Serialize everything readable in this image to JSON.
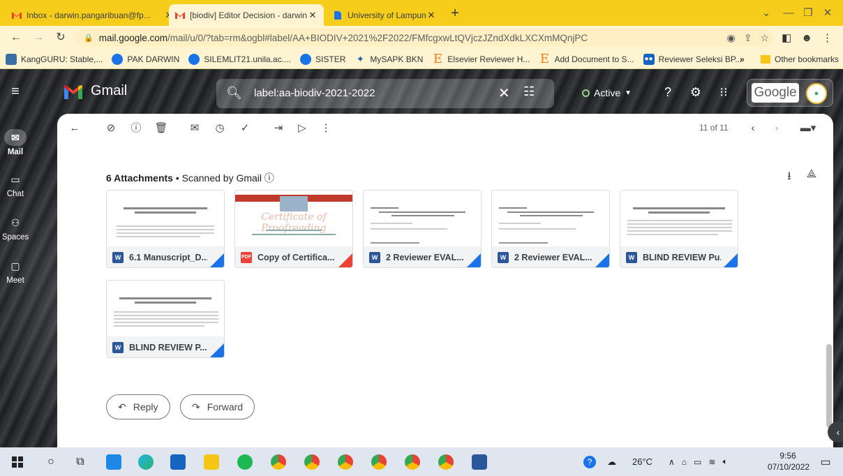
{
  "browser": {
    "tabs": [
      {
        "label": "Inbox - darwin.pangaribuan@fp...",
        "icon": "gmail-icon",
        "active": false
      },
      {
        "label": "[biodiv] Editor Decision - darwin...",
        "icon": "gmail-icon",
        "active": true
      },
      {
        "label": "University of Lampung | LPPM-U...",
        "icon": "doc-icon",
        "active": false
      }
    ],
    "close_glyph": "✕",
    "newtab_glyph": "+",
    "url_host": "mail.google.com",
    "url_path": "/mail/u/0/?tab=rm&ogbl#label/AA+BIODIV+2021%2F2022/FMfcgxwLtQVjczJZndXdkLXCXmMQnjPC",
    "bookmarks": [
      {
        "label": "KangGURU: Stable,...",
        "icon": "kangguru-icon",
        "color": "#3a6ea5"
      },
      {
        "label": "PAK DARWIN",
        "icon": "globe-icon",
        "color": "#1a73e8"
      },
      {
        "label": "SILEMLIT21.unila.ac....",
        "icon": "globe-icon",
        "color": "#1a73e8"
      },
      {
        "label": "SISTER",
        "icon": "globe-icon",
        "color": "#1a73e8"
      },
      {
        "label": "MySAPK BKN",
        "icon": "bkn-icon",
        "color": "#0f5fa8"
      },
      {
        "label": "Elsevier Reviewer H...",
        "icon": "elsevier-icon",
        "color": "#f07c1a"
      },
      {
        "label": "Add Document to S...",
        "icon": "elsevier-icon",
        "color": "#f07c1a"
      },
      {
        "label": "Reviewer Seleksi BP...",
        "icon": "people-icon",
        "color": "#1565c0"
      }
    ],
    "bookmarks_more": "»",
    "other_bookmarks": "Other bookmarks"
  },
  "gmail": {
    "app_name": "Gmail",
    "search_query": "label:aa-biodiv-2021-2022",
    "status": "Active",
    "google_label": "Google",
    "rail": [
      {
        "label": "Mail",
        "icon": "mail-icon",
        "active": true
      },
      {
        "label": "Chat",
        "icon": "chat-icon",
        "active": false
      },
      {
        "label": "Spaces",
        "icon": "spaces-icon",
        "active": false
      },
      {
        "label": "Meet",
        "icon": "meet-icon",
        "active": false
      }
    ],
    "pager": "11 of 11",
    "attachments_title": "6 Attachments",
    "scanned_text": " • Scanned by Gmail ⓘ",
    "attachments": [
      {
        "name": "6.1 Manuscript_D...",
        "type": "W",
        "color": "#2b579a",
        "corner": "#1a73e8"
      },
      {
        "name": "Copy of Certifica...",
        "type": "PDF",
        "color": "#ea4335",
        "corner": "#ea4335"
      },
      {
        "name": "2 Reviewer EVAL...",
        "type": "W",
        "color": "#2b579a",
        "corner": "#1a73e8"
      },
      {
        "name": "2 Reviewer EVAL...",
        "type": "W",
        "color": "#2b579a",
        "corner": "#1a73e8"
      },
      {
        "name": "BLIND REVIEW Pu...",
        "type": "W",
        "color": "#2b579a",
        "corner": "#1a73e8"
      },
      {
        "name": "BLIND REVIEW P...",
        "type": "W",
        "color": "#2b579a",
        "corner": "#1a73e8"
      }
    ],
    "certificate_title": "Certificate of Proofreading",
    "reply_label": "Reply",
    "forward_label": "Forward"
  },
  "taskbar": {
    "temperature": "26°C",
    "time": "9:56",
    "date": "07/10/2022"
  }
}
